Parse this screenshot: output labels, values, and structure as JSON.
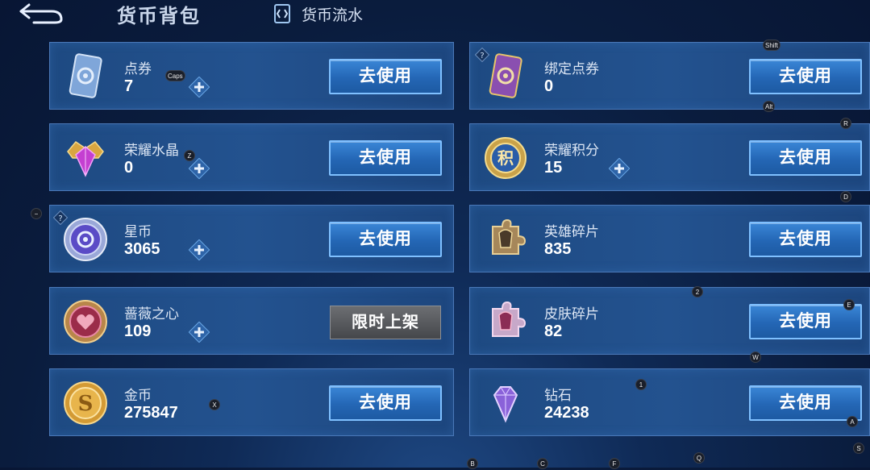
{
  "header": {
    "title": "货币背包",
    "flow_tab": "货币流水"
  },
  "currencies": [
    {
      "name": "点券",
      "value": "7",
      "action": "去使用"
    },
    {
      "name": "绑定点券",
      "value": "0",
      "action": "去使用"
    },
    {
      "name": "荣耀水晶",
      "value": "0",
      "action": "去使用"
    },
    {
      "name": "荣耀积分",
      "value": "15",
      "action": "去使用"
    },
    {
      "name": "星币",
      "value": "3065",
      "action": "去使用"
    },
    {
      "name": "英雄碎片",
      "value": "835",
      "action": "去使用"
    },
    {
      "name": "蔷薇之心",
      "value": "109",
      "action": "限时上架"
    },
    {
      "name": "皮肤碎片",
      "value": "82",
      "action": "去使用"
    },
    {
      "name": "金币",
      "value": "275847",
      "action": "去使用"
    },
    {
      "name": "钻石",
      "value": "24238",
      "action": "去使用"
    }
  ],
  "key_hints": [
    "Shift",
    "Caps",
    "Alt",
    "R",
    "Z",
    "D",
    "−",
    "2",
    "E",
    "W",
    "1",
    "X",
    "A",
    "S",
    "Q",
    "B",
    "C",
    "F"
  ],
  "colors": {
    "button_blue": "#2a70c2",
    "button_border": "#7fc0ff",
    "card_bg": "#21508c",
    "disabled_gray": "#55575b"
  }
}
